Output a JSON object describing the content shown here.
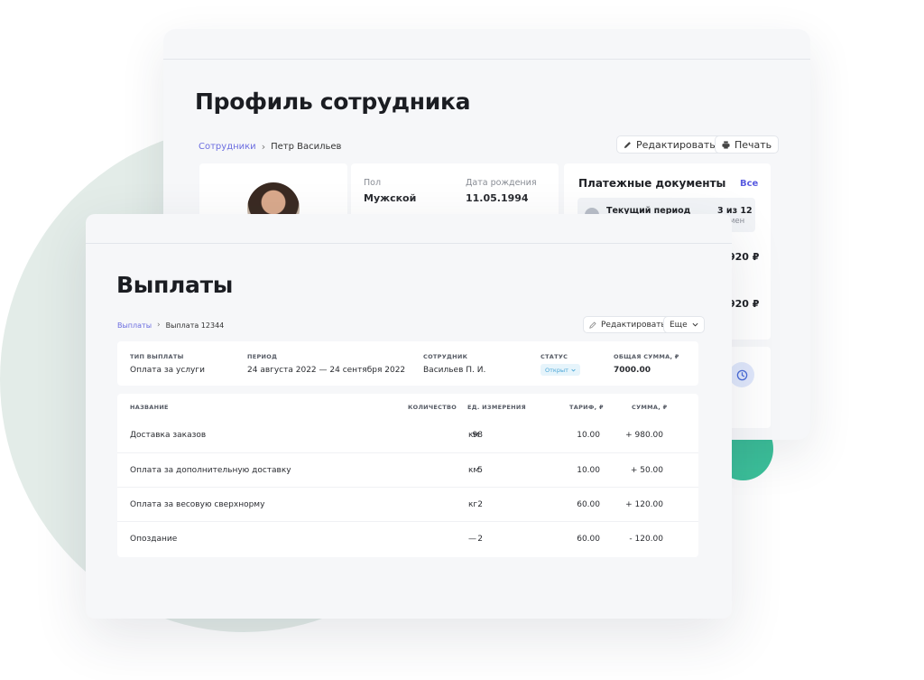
{
  "profile": {
    "title": "Профиль сотрудника",
    "breadcrumb": {
      "parent": "Сотрудники",
      "current": "Петр Васильев"
    },
    "buttons": {
      "edit": "Редактировать",
      "print": "Печать"
    },
    "fields": [
      {
        "label": "Пол",
        "value": "Мужской"
      },
      {
        "label": "Дата рождения",
        "value": "11.05.1994"
      }
    ],
    "payment_docs": {
      "title": "Платежные документы",
      "all_link": "Все",
      "current_period": {
        "label": "Текущий период",
        "count": "3 из 12",
        "sub": "мен"
      },
      "amounts": [
        "920 ₽",
        "920 ₽"
      ]
    }
  },
  "payments": {
    "title": "Выплаты",
    "breadcrumb": {
      "parent": "Выплаты",
      "current": "Выплата 12344"
    },
    "buttons": {
      "edit": "Редактировать",
      "more": "Еще"
    },
    "info": {
      "type": {
        "label": "ТИП ВЫПЛАТЫ",
        "value": "Оплата за услуги"
      },
      "period": {
        "label": "ПЕРИОД",
        "value": "24 августа 2022 — 24 сентября 2022"
      },
      "employee": {
        "label": "СОТРУДНИК",
        "value": "Васильев П. И."
      },
      "status": {
        "label": "СТАТУС",
        "value": "Открыт"
      },
      "total": {
        "label": "ОБЩАЯ СУММА, ₽",
        "value": "7000.00"
      }
    },
    "table": {
      "headers": {
        "name": "НАЗВАНИЕ",
        "qty": "КОЛИЧЕСТВО",
        "unit": "ЕД. ИЗМЕРЕНИЯ",
        "rate": "ТАРИФ, ₽",
        "sum": "СУММА, ₽"
      },
      "rows": [
        {
          "name": "Доставка заказов",
          "qty": "98",
          "unit": "км",
          "rate": "10.00",
          "sum": "+ 980.00"
        },
        {
          "name": "Оплата за дополнительную доставку",
          "qty": "5",
          "unit": "км",
          "rate": "10.00",
          "sum": "+ 50.00"
        },
        {
          "name": "Оплата за весовую сверхнорму",
          "qty": "2",
          "unit": "кг",
          "rate": "60.00",
          "sum": "+ 120.00"
        },
        {
          "name": "Опоздание",
          "qty": "2",
          "unit": "—",
          "rate": "60.00",
          "sum": "- 120.00"
        }
      ]
    }
  },
  "colors": {
    "accent": "#5a5ce0",
    "green": "#3cc29b",
    "status": "#4aa6d6",
    "bg_circle": "#e3ece8"
  }
}
